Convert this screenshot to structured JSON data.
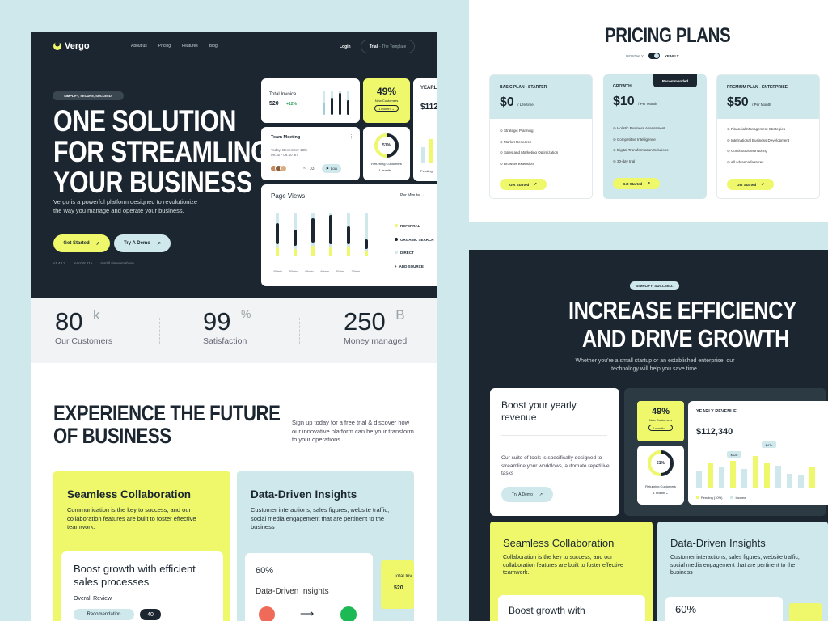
{
  "brand": {
    "name": "Vergo"
  },
  "nav": {
    "links": [
      "About us",
      "Pricing",
      "Features",
      "Blog"
    ],
    "login": "Login",
    "trial": "Trial",
    "trial_sub": "- The Template"
  },
  "hero": {
    "badge": "SIMPLIFY, SECURE, SUCCEED.",
    "title_l1": "ONE SOLUTION",
    "title_l2": "FOR STREAMLING",
    "title_l3": "YOUR BUSINESS",
    "desc": "Vergo is a powerful platform designed to revolutionize the way you manage and operate your business.",
    "get_started": "Get Started",
    "try_demo": "Try A Demo",
    "meta": [
      "v1.43.2",
      "macOS 11+",
      "Install via Homebrew"
    ]
  },
  "widgets": {
    "invoice": {
      "label": "Total Invoice",
      "value": "520",
      "delta": "+12%"
    },
    "new_customers": {
      "pct": "49%",
      "label": "New Customers",
      "select": "1 month"
    },
    "yearly_clip": "YEARL",
    "yearly_clip_val": "$112",
    "meeting": {
      "title": "Team Meeting",
      "date": "Today, December 18th",
      "time": "09:30 - 09:30 am",
      "count": "03",
      "priority": "Low"
    },
    "returning": {
      "pct": "51%",
      "label": "Returning Customers",
      "select": "1 month"
    },
    "pending": "Pending",
    "pageviews": {
      "title": "Page Views",
      "filter": "Per Minute",
      "legend": [
        "REFERRAL",
        "ORGANIC SEARCH",
        "DIRECT",
        "ADD SOURCE"
      ],
      "ticks": [
        "-55min",
        "-50min",
        "-45min",
        "-40min",
        "-35min",
        "-30min"
      ]
    }
  },
  "stats": [
    {
      "value": "80",
      "unit": "k",
      "label": "Our Customers"
    },
    {
      "value": "99",
      "unit": "%",
      "label": "Satisfaction"
    },
    {
      "value": "250",
      "unit": "B",
      "label": "Money managed"
    }
  ],
  "experience": {
    "title_l1": "EXPERIENCE THE FUTURE",
    "title_l2": "OF BUSINESS",
    "desc": "Sign up today for a free trial & discover how our innovative platform can be your transform to your operations."
  },
  "features": {
    "collab": {
      "title": "Seamless Collaboration",
      "desc": "Communication is the key to success, and our collaboration features are built to foster effective teamwork.",
      "inner_title": "Boost growth with efficient sales processes",
      "review": "Overall Review",
      "rec": "Recomendation",
      "score": "40"
    },
    "insights": {
      "title": "Data-Driven Insights",
      "desc": "Customer interactions, sales figures, website traffic, social media engagement that are pertinent to the business",
      "pct": "60%",
      "inner": "Data-Driven Insights",
      "clip": "Total Inv",
      "clip_val": "520"
    }
  },
  "pricing": {
    "title": "PRICING PLANS",
    "toggle_left": "MONTHLY",
    "toggle_right": "YEARLY",
    "plans": [
      {
        "name": "BASIC PLAN - STARTER",
        "price": "$0",
        "period": "/ Life time",
        "items": [
          "Strategic Planning",
          "Market Research",
          "Sales and Marketing Optimization",
          "Browser extension"
        ],
        "cta": "Get Started"
      },
      {
        "name": "GROWTH",
        "price": "$10",
        "period": "/ Per Month",
        "badge": "Recommended",
        "items": [
          "Holistic Business Assessment",
          "Competitive Intelligence",
          "Digital Transformation Solutions",
          "30-day trial"
        ],
        "cta": "Get Started"
      },
      {
        "name": "PREMIUM PLAN - ENTERPRISE",
        "price": "$50",
        "period": "/ Per Month",
        "items": [
          "Financial Management Strategies",
          "International Business Development",
          "Continuous Monitoring",
          "All advance features"
        ],
        "cta": "Get Started"
      }
    ]
  },
  "growth": {
    "badge": "SIMPLIFY, SUCCEED.",
    "title_l1": "INCREASE EFFICIENCY",
    "title_l2": "AND DRIVE GROWTH",
    "desc": "Whether you're a small startup or an established enterprise, our technology will help you save time.",
    "boost": {
      "title": "Boost your yearly revenue",
      "desc": "Our suite of tools is specifically designed to streamline your workflows, automate repetitive tasks",
      "cta": "Try A Demo"
    },
    "new_pct": "49%",
    "new_label": "New Customers",
    "ret_pct": "51%",
    "ret_label": "Returning Customers",
    "month": "1 month",
    "revenue": {
      "title": "YEARLY REVENUE",
      "value": "$112,340",
      "tag1": "$12k",
      "tag2": "$47k",
      "legend1": "Pending (10%)",
      "legend2": "Income"
    },
    "collab": {
      "title": "Seamless Collaboration",
      "desc": "Collaboration is the key to success, and our collaboration features are built to foster effective teamwork.",
      "inner": "Boost growth with"
    },
    "insights": {
      "title": "Data-Driven Insights",
      "desc": "Customer interactions, sales figures, website traffic, social media engagement that are pertinent to the business",
      "pct": "60%"
    }
  }
}
